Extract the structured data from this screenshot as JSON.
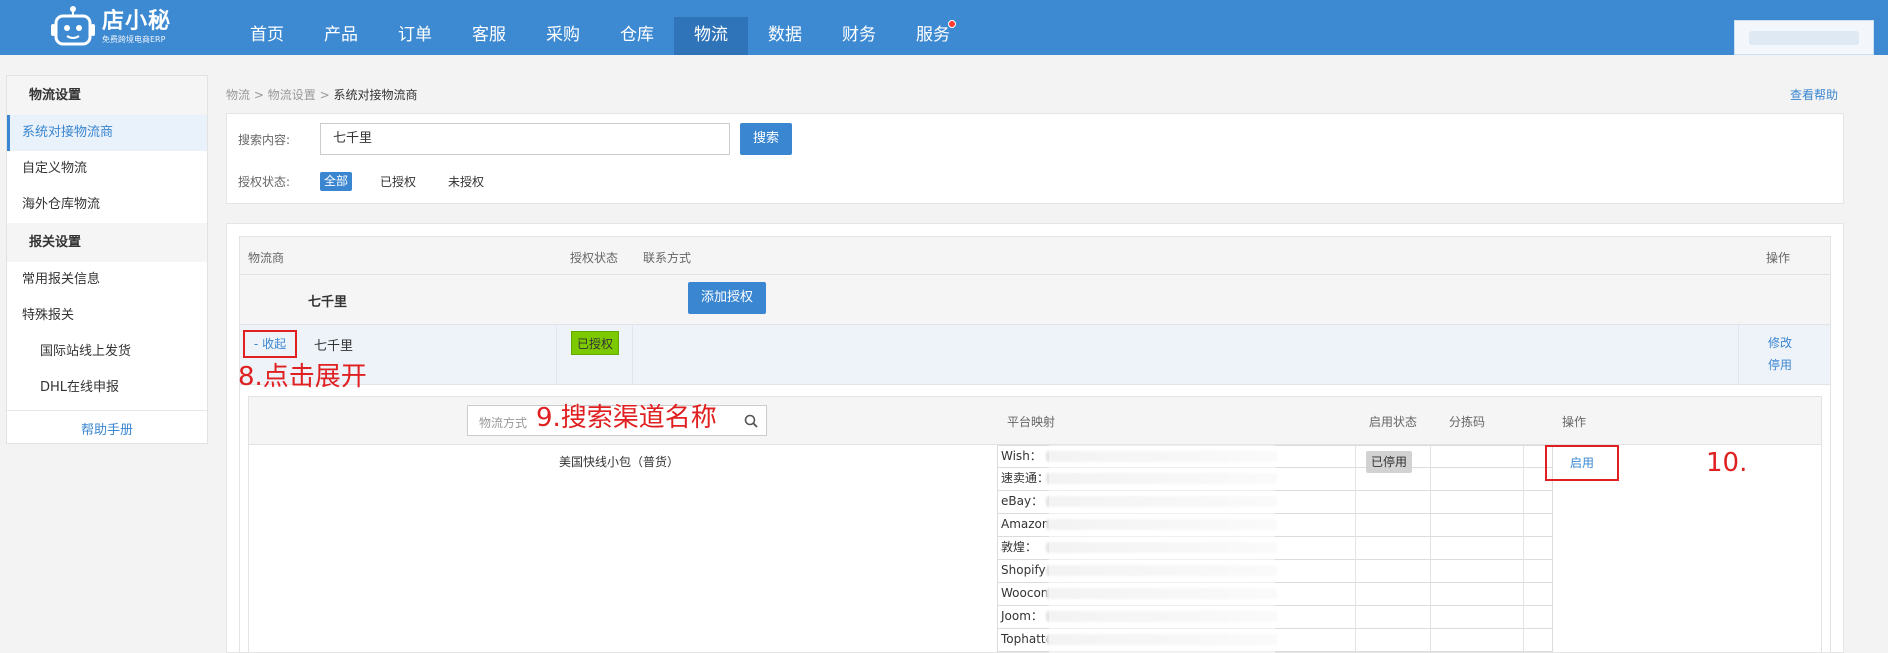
{
  "app": {
    "logo_name": "店小秘",
    "logo_sub": "免费跨境电商ERP"
  },
  "nav": {
    "items": [
      {
        "label": "首页"
      },
      {
        "label": "产品"
      },
      {
        "label": "订单"
      },
      {
        "label": "客服"
      },
      {
        "label": "采购"
      },
      {
        "label": "仓库"
      },
      {
        "label": "物流",
        "active": true
      },
      {
        "label": "数据"
      },
      {
        "label": "财务"
      },
      {
        "label": "服务",
        "badge_dot": true
      }
    ]
  },
  "sidebar": {
    "group1": "物流设置",
    "items1": [
      "系统对接物流商",
      "自定义物流",
      "海外仓库物流"
    ],
    "group2": "报关设置",
    "items2": [
      "常用报关信息",
      "特殊报关"
    ],
    "subitems2": [
      "国际站线上发货",
      "DHL在线申报"
    ],
    "help": "帮助手册"
  },
  "breadcrumb": {
    "level1": "物流",
    "level2": "物流设置",
    "current": "系统对接物流商",
    "separator": ">"
  },
  "help_link": "查看帮助",
  "search": {
    "label": "搜索内容:",
    "value": "七千里",
    "button": "搜索",
    "auth_label": "授权状态:",
    "auth_all": "全部",
    "auth_yes": "已授权",
    "auth_no": "未授权"
  },
  "table": {
    "headers": {
      "provider": "物流商",
      "auth_status": "授权状态",
      "contact": "联系方式",
      "ops": "操作"
    },
    "group_name": "七千里",
    "add_auth_button": "添加授权",
    "row": {
      "collapse": "- 收起",
      "name": "七千里",
      "auth_badge": "已授权",
      "edit": "修改",
      "disable": "停用"
    }
  },
  "channels": {
    "search_placeholder": "物流方式",
    "headers": {
      "platform_mapping": "平台映射",
      "enable_status": "启用状态",
      "sort_code": "分拣码",
      "ops": "操作"
    },
    "row": {
      "name": "美国快线小包（普货）",
      "status": "已停用",
      "action": "启用",
      "mappings": [
        "Wish：",
        "速卖通：",
        "eBay：",
        "Amazon",
        "敦煌：",
        "Shopify",
        "Woocon",
        "Joom：",
        "Tophatte"
      ]
    }
  },
  "annotations": {
    "step8": "8.点击展开",
    "step9": "9.搜索渠道名称",
    "step10": "10."
  },
  "colors": {
    "topbar": "#3d8ad2",
    "accent": "#3a86d0",
    "annotation_red": "#e02020",
    "authorized_green": "#7cc900"
  }
}
